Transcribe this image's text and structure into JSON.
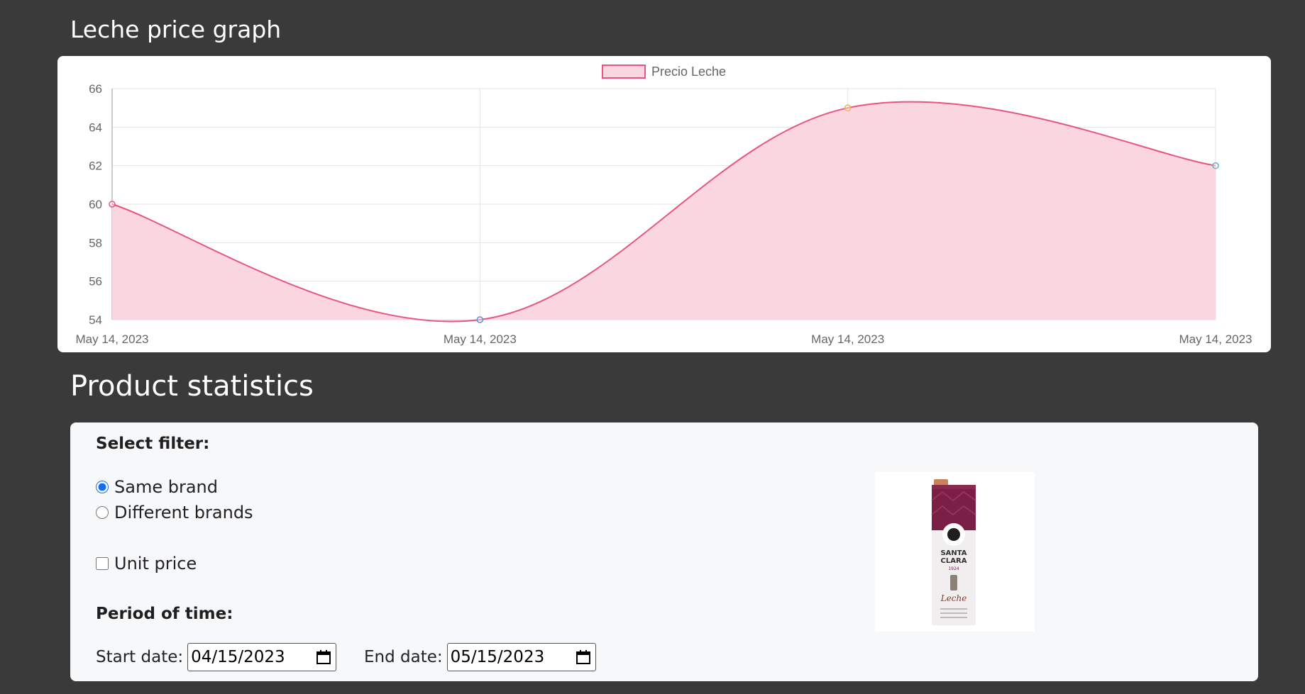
{
  "headings": {
    "graph_title": "Leche price graph",
    "stats_title": "Product statistics"
  },
  "chart_data": {
    "type": "area",
    "title": "",
    "xlabel": "",
    "ylabel": "",
    "x": [
      "May 14, 2023",
      "May 14, 2023",
      "May 14, 2023",
      "May 14, 2023"
    ],
    "series": [
      {
        "name": "Precio Leche",
        "values": [
          60,
          54,
          65,
          62
        ],
        "line_color": "#e8557e",
        "fill_color": "#f9d6e0",
        "point_colors": [
          "#e8557e",
          "#5b8fd9",
          "#f0b056",
          "#5fb4c7"
        ]
      }
    ],
    "ylim": [
      54,
      66
    ],
    "yticks": [
      54,
      56,
      58,
      60,
      62,
      64,
      66
    ],
    "grid": true,
    "legend": "top-center"
  },
  "filters": {
    "select_label": "Select filter:",
    "same_brand": "Same brand",
    "different_brands": "Different brands",
    "unit_price": "Unit price",
    "selected": "same_brand",
    "unit_price_checked": false
  },
  "period": {
    "label": "Period of time:",
    "start_label": "Start date:",
    "start_value": "04/15/2023",
    "end_label": "End date:",
    "end_value": "05/15/2023"
  },
  "product": {
    "brand_line1": "SANTA",
    "brand_line2": "CLARA",
    "year": "1924",
    "product_name": "Leche"
  }
}
